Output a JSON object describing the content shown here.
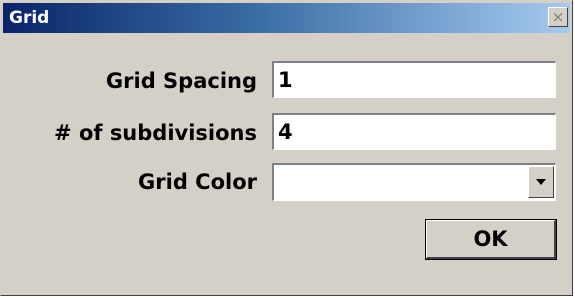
{
  "window": {
    "title": "Grid",
    "close_glyph": "×"
  },
  "form": {
    "grid_spacing": {
      "label": "Grid Spacing",
      "value": "1"
    },
    "subdivisions": {
      "label": "# of subdivisions",
      "value": "4"
    },
    "grid_color": {
      "label": "Grid Color",
      "value": ""
    }
  },
  "buttons": {
    "ok_label": "OK"
  },
  "icons": {
    "close": "close-icon",
    "dropdown": "chevron-down-icon"
  },
  "colors": {
    "titlebar_start": "#0a246a",
    "titlebar_end": "#a6caf0",
    "dialog_face": "#d4d0c8"
  }
}
